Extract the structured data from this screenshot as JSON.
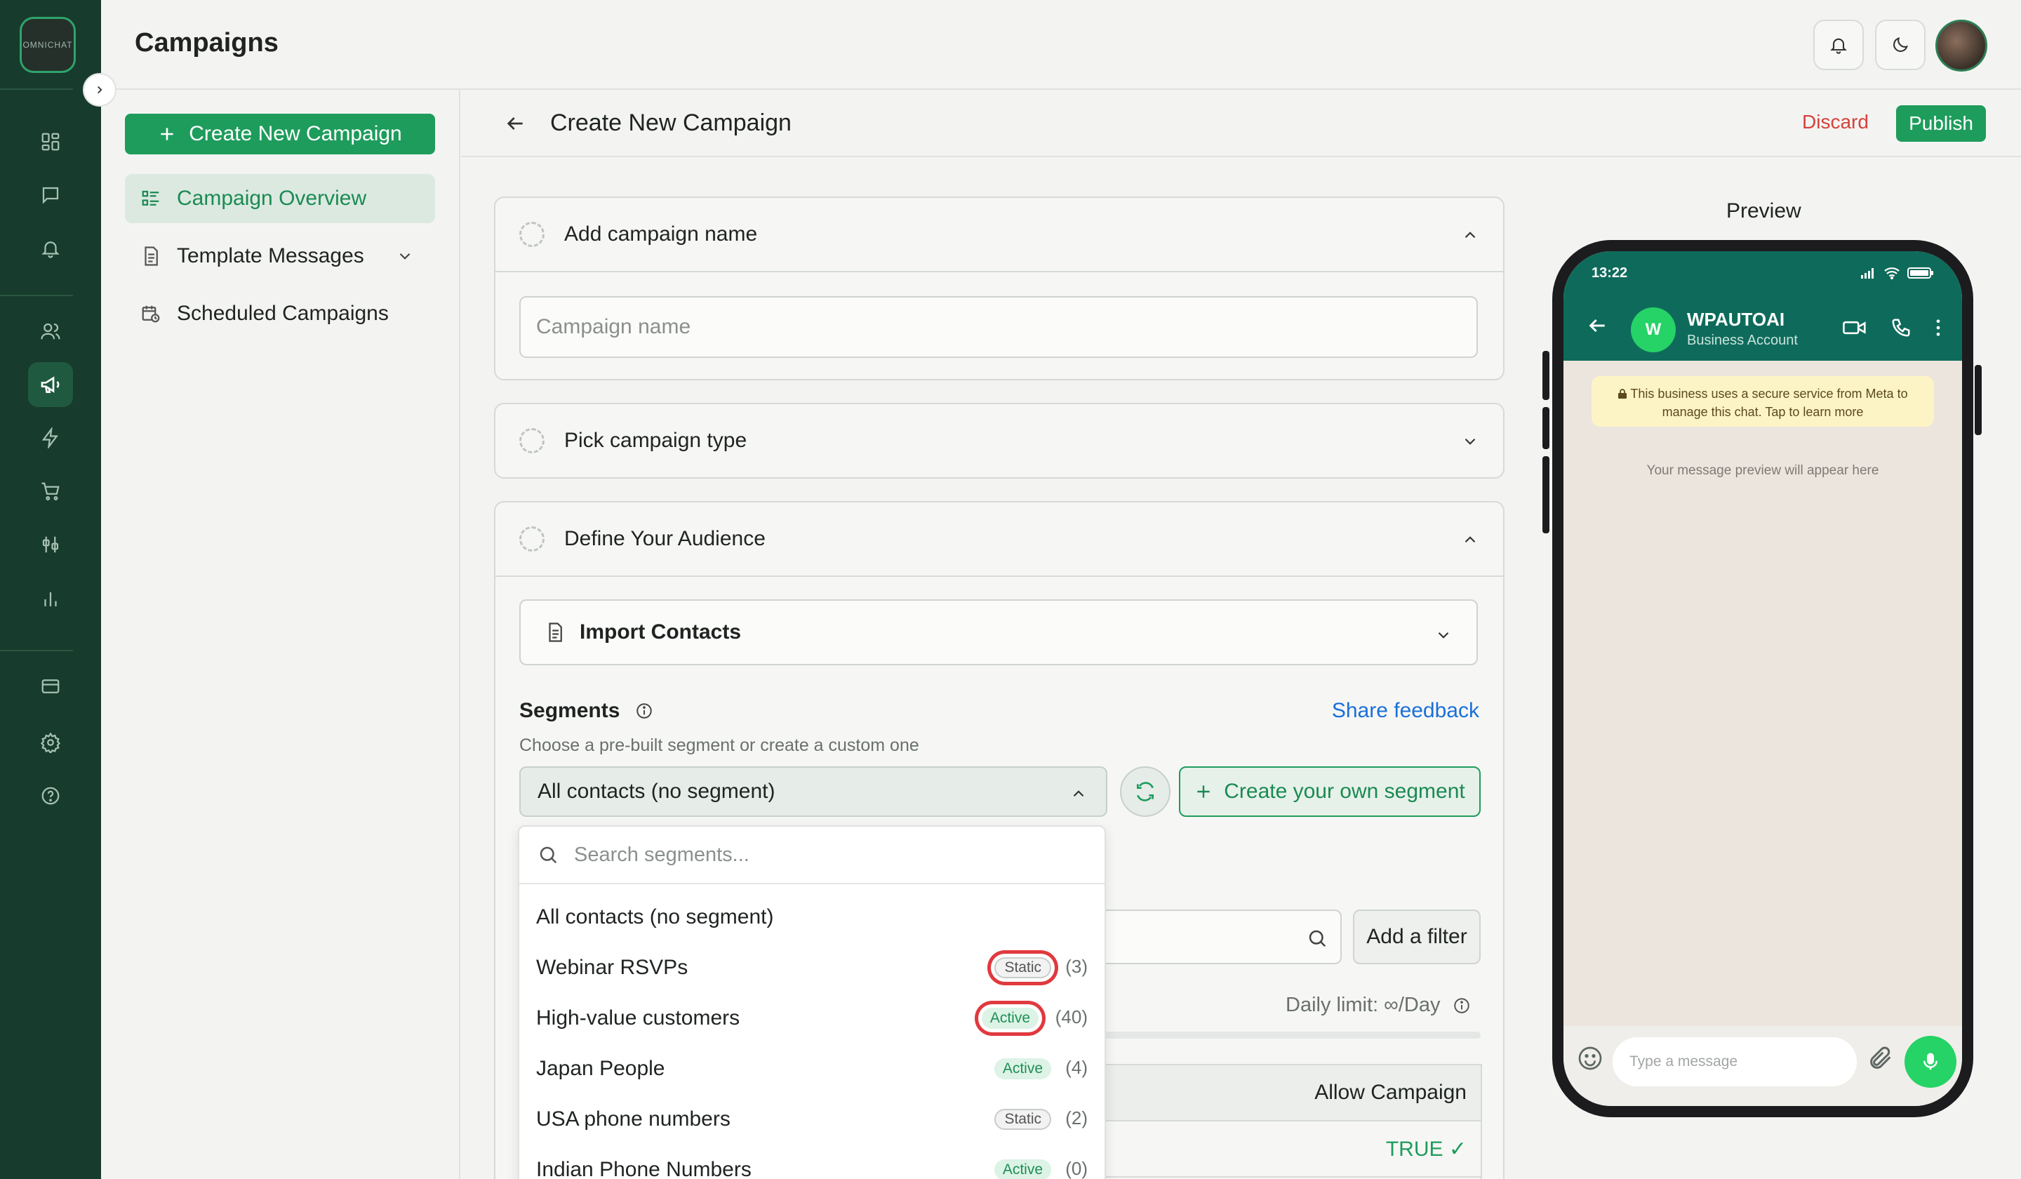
{
  "rail": {
    "logo_text": "OMNICHAT",
    "icons": [
      "dashboard-icon",
      "chat-icon",
      "bell-icon",
      "contacts-icon",
      "megaphone-icon",
      "lightning-icon",
      "cart-icon",
      "integrations-icon",
      "analytics-icon",
      "billing-icon",
      "settings-icon",
      "help-icon"
    ],
    "active": "megaphone-icon"
  },
  "header": {
    "title": "Campaigns"
  },
  "sidenav": {
    "create_label": "Create New Campaign",
    "items": [
      {
        "label": "Campaign Overview"
      },
      {
        "label": "Template Messages"
      },
      {
        "label": "Scheduled Campaigns"
      }
    ]
  },
  "main": {
    "title": "Create New Campaign",
    "discard_label": "Discard",
    "publish_label": "Publish"
  },
  "steps": {
    "name": {
      "title": "Add campaign name",
      "placeholder": "Campaign name"
    },
    "type": {
      "title": "Pick campaign type"
    },
    "audience": {
      "title": "Define Your Audience",
      "import_label": "Import Contacts",
      "segments_label": "Segments",
      "share_feedback": "Share feedback",
      "segments_hint": "Choose a pre-built segment or create a custom one",
      "selected_segment": "All contacts (no segment)",
      "create_segment_label": "Create your own segment",
      "add_filter_label": "Add a filter",
      "daily_limit": "Daily limit: ∞/Day",
      "allow_header": "Allow Campaign",
      "allow_value": "TRUE ✓"
    }
  },
  "dropdown": {
    "search_placeholder": "Search segments...",
    "items": [
      {
        "name": "All contacts (no segment)"
      },
      {
        "name": "Webinar RSVPs",
        "badge": "Static",
        "count": "(3)"
      },
      {
        "name": "High-value customers",
        "badge": "Active",
        "count": "(40)"
      },
      {
        "name": "Japan People",
        "badge": "Active",
        "count": "(4)"
      },
      {
        "name": "USA phone numbers",
        "badge": "Static",
        "count": "(2)"
      },
      {
        "name": "Indian Phone Numbers",
        "badge": "Active",
        "count": "(0)"
      }
    ]
  },
  "preview": {
    "title": "Preview",
    "time": "13:22",
    "business_name": "WPAUTOAI",
    "business_sub": "Business Account",
    "avatar_letter": "W",
    "meta_note": "This business uses a secure service from Meta to manage this chat. Tap to learn more",
    "hint": "Your message preview will appear here",
    "input_placeholder": "Type a message"
  },
  "colors": {
    "brand": "#1e9c5c",
    "rail_bg": "#173b2c",
    "whatsapp_header": "#0e6b5b",
    "danger": "#d7413b",
    "link": "#1b6fd8"
  }
}
